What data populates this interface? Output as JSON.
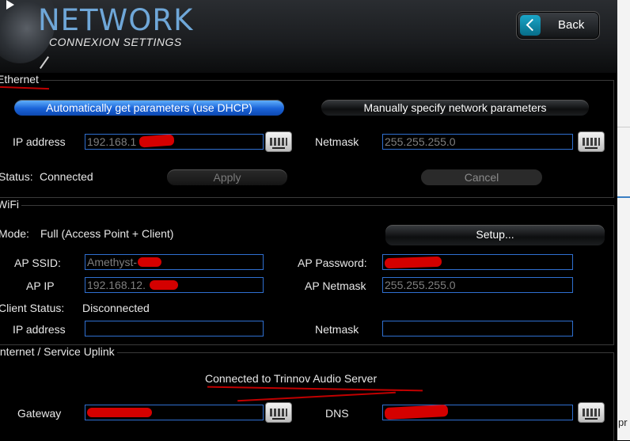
{
  "header": {
    "title": "NETWORK",
    "subtitle": "CONNEXION SETTINGS",
    "back_label": "Back"
  },
  "ethernet": {
    "legend": "Ethernet",
    "dhcp_button": "Automatically get parameters (use DHCP)",
    "manual_button": "Manually specify network parameters",
    "ip_label": "IP address",
    "ip_value": "192.168.1",
    "netmask_label": "Netmask",
    "netmask_value": "255.255.255.0",
    "status_label": "Status:",
    "status_value": "Connected",
    "apply_button": "Apply",
    "cancel_button": "Cancel"
  },
  "wifi": {
    "legend": "WiFi",
    "mode_label": "Mode:",
    "mode_value": "Full (Access Point + Client)",
    "setup_button": "Setup...",
    "ssid_label": "AP SSID:",
    "ssid_value": "Amethyst-",
    "password_label": "AP Password:",
    "password_value": "",
    "ap_ip_label": "AP IP",
    "ap_ip_value": "192.168.12.",
    "ap_netmask_label": "AP Netmask",
    "ap_netmask_value": "255.255.255.0",
    "client_status_label": "Client Status:",
    "client_status_value": "Disconnected",
    "ip_label": "IP address",
    "ip_value": "",
    "netmask_label": "Netmask",
    "netmask_value": ""
  },
  "uplink": {
    "legend": "Internet / Service Uplink",
    "status_text": "Connected to Trinnov Audio Server",
    "gateway_label": "Gateway",
    "gateway_value": "",
    "dns_label": "DNS",
    "dns_value": ""
  },
  "side": {
    "cut_text": "pr"
  },
  "colors": {
    "field_border": "#2f6fd0",
    "title_blue": "#6fa7d8",
    "dhcp_active": "#1a63d8",
    "annotation_red": "#c00000"
  },
  "icons": [
    "play-icon",
    "back-chevron-icon",
    "keyboard-icon"
  ]
}
